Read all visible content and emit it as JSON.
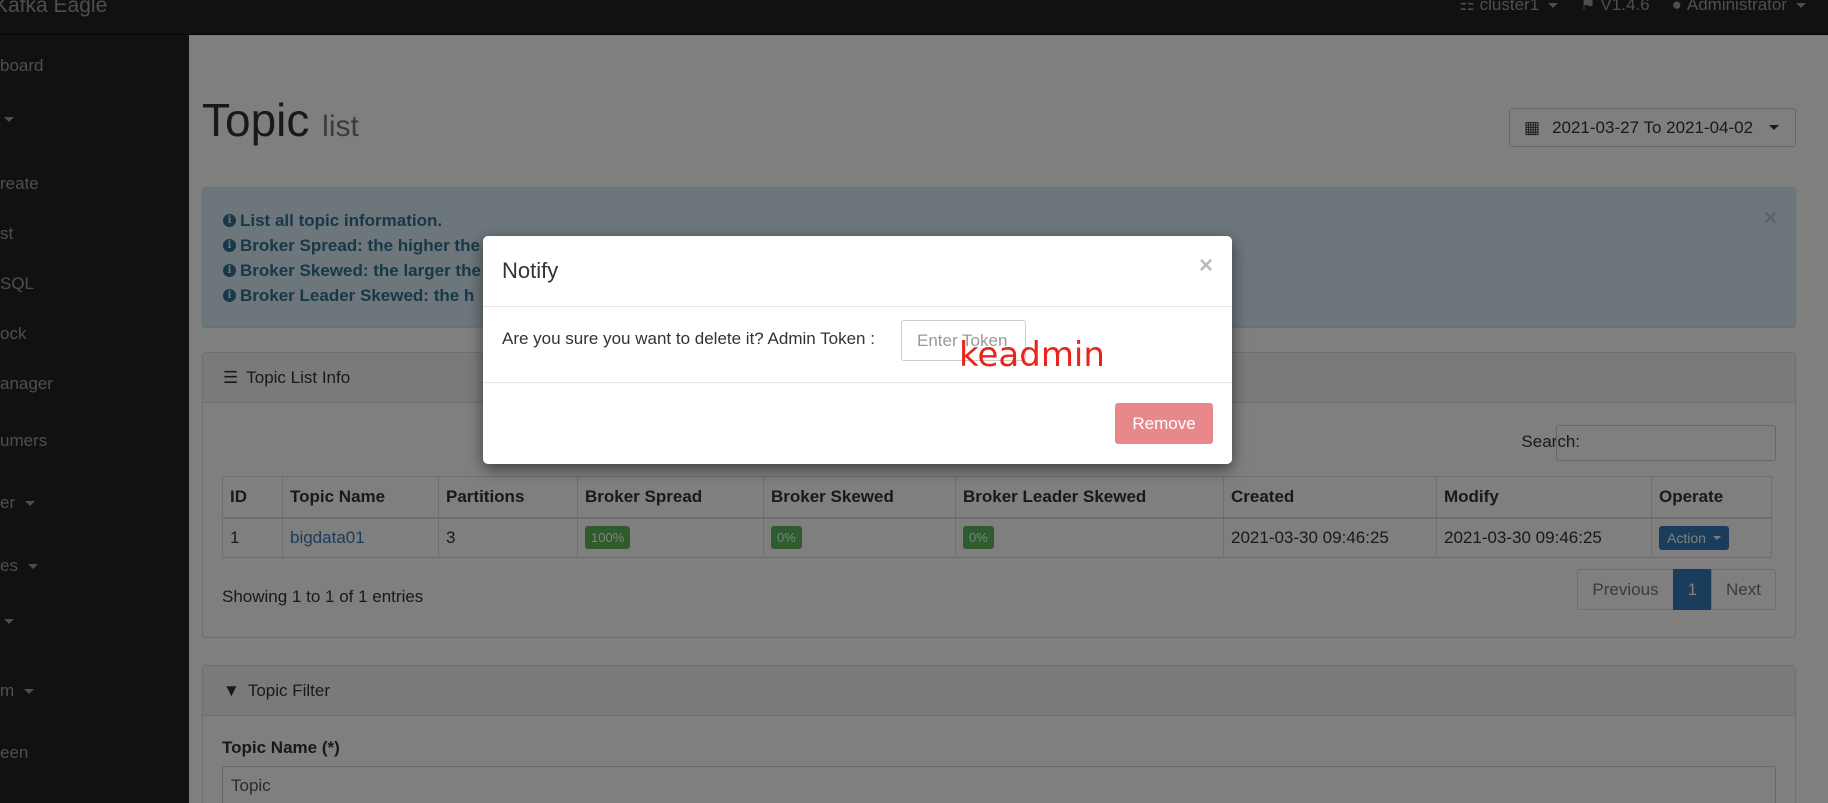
{
  "navbar": {
    "brand": "Kafka Eagle",
    "cluster": "cluster1",
    "version": "V1.4.6",
    "user": "Administrator"
  },
  "sidebar": {
    "items": [
      "board",
      "",
      "reate",
      "st",
      "SQL",
      "ock",
      "anager",
      "umers",
      "er",
      "es",
      "",
      "m",
      "een"
    ]
  },
  "page": {
    "title": "Topic",
    "subtitle": "list",
    "date_range": "2021-03-27 To 2021-04-02"
  },
  "alert": {
    "lines": [
      "List all topic information.",
      "Broker Spread: the higher the",
      "Broker Skewed: the larger the",
      "Broker Leader Skewed: the h"
    ],
    "close": "×"
  },
  "topic_panel": {
    "heading": "Topic List Info",
    "search_label": "Search:",
    "columns": [
      "ID",
      "Topic Name",
      "Partitions",
      "Broker Spread",
      "Broker Skewed",
      "Broker Leader Skewed",
      "Created",
      "Modify",
      "Operate"
    ],
    "rows": [
      {
        "id": "1",
        "topic_name": "bigdata01",
        "partitions": "3",
        "broker_spread": "100%",
        "broker_skewed": "0%",
        "broker_leader_skewed": "0%",
        "created": "2021-03-30 09:46:25",
        "modify": "2021-03-30 09:46:25",
        "operate": "Action"
      }
    ],
    "showing": "Showing 1 to 1 of 1 entries",
    "pager": {
      "previous": "Previous",
      "page": "1",
      "next": "Next"
    }
  },
  "filter_panel": {
    "heading": "Topic Filter",
    "label": "Topic Name (*)",
    "placeholder": "Topic"
  },
  "modal": {
    "title": "Notify",
    "close": "×",
    "message": "Are you sure you want to delete it? Admin Token :",
    "token_placeholder": "Enter Token",
    "annotation": "keadmin",
    "remove_label": "Remove"
  },
  "colors": {
    "navbar_bg": "#222222",
    "alert_bg": "#d9edf7",
    "success": "#5cb85c",
    "primary": "#337ab7",
    "danger_disabled": "#e8888a",
    "annotation": "#e8241b"
  }
}
